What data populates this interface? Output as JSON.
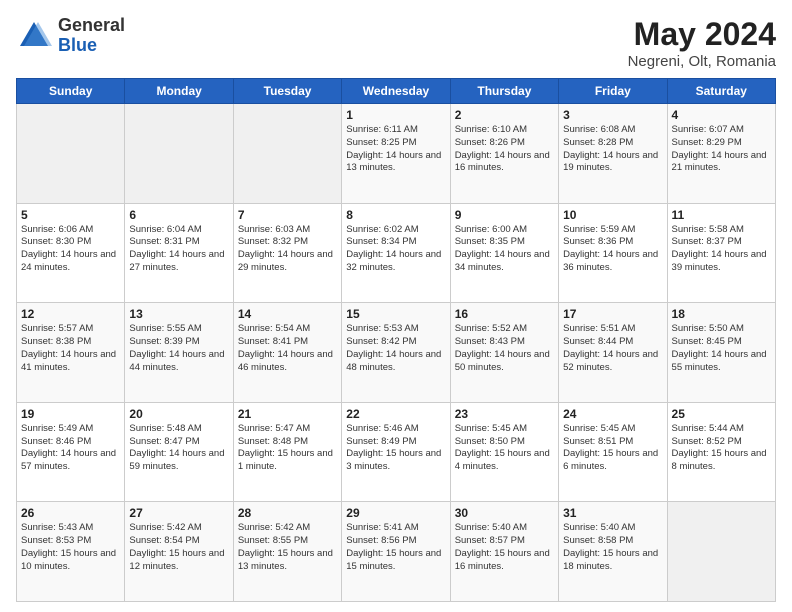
{
  "header": {
    "logo_general": "General",
    "logo_blue": "Blue",
    "title": "May 2024",
    "location": "Negreni, Olt, Romania"
  },
  "days_of_week": [
    "Sunday",
    "Monday",
    "Tuesday",
    "Wednesday",
    "Thursday",
    "Friday",
    "Saturday"
  ],
  "weeks": [
    [
      {
        "day": "",
        "info": ""
      },
      {
        "day": "",
        "info": ""
      },
      {
        "day": "",
        "info": ""
      },
      {
        "day": "1",
        "info": "Sunrise: 6:11 AM\nSunset: 8:25 PM\nDaylight: 14 hours and 13 minutes."
      },
      {
        "day": "2",
        "info": "Sunrise: 6:10 AM\nSunset: 8:26 PM\nDaylight: 14 hours and 16 minutes."
      },
      {
        "day": "3",
        "info": "Sunrise: 6:08 AM\nSunset: 8:28 PM\nDaylight: 14 hours and 19 minutes."
      },
      {
        "day": "4",
        "info": "Sunrise: 6:07 AM\nSunset: 8:29 PM\nDaylight: 14 hours and 21 minutes."
      }
    ],
    [
      {
        "day": "5",
        "info": "Sunrise: 6:06 AM\nSunset: 8:30 PM\nDaylight: 14 hours and 24 minutes."
      },
      {
        "day": "6",
        "info": "Sunrise: 6:04 AM\nSunset: 8:31 PM\nDaylight: 14 hours and 27 minutes."
      },
      {
        "day": "7",
        "info": "Sunrise: 6:03 AM\nSunset: 8:32 PM\nDaylight: 14 hours and 29 minutes."
      },
      {
        "day": "8",
        "info": "Sunrise: 6:02 AM\nSunset: 8:34 PM\nDaylight: 14 hours and 32 minutes."
      },
      {
        "day": "9",
        "info": "Sunrise: 6:00 AM\nSunset: 8:35 PM\nDaylight: 14 hours and 34 minutes."
      },
      {
        "day": "10",
        "info": "Sunrise: 5:59 AM\nSunset: 8:36 PM\nDaylight: 14 hours and 36 minutes."
      },
      {
        "day": "11",
        "info": "Sunrise: 5:58 AM\nSunset: 8:37 PM\nDaylight: 14 hours and 39 minutes."
      }
    ],
    [
      {
        "day": "12",
        "info": "Sunrise: 5:57 AM\nSunset: 8:38 PM\nDaylight: 14 hours and 41 minutes."
      },
      {
        "day": "13",
        "info": "Sunrise: 5:55 AM\nSunset: 8:39 PM\nDaylight: 14 hours and 44 minutes."
      },
      {
        "day": "14",
        "info": "Sunrise: 5:54 AM\nSunset: 8:41 PM\nDaylight: 14 hours and 46 minutes."
      },
      {
        "day": "15",
        "info": "Sunrise: 5:53 AM\nSunset: 8:42 PM\nDaylight: 14 hours and 48 minutes."
      },
      {
        "day": "16",
        "info": "Sunrise: 5:52 AM\nSunset: 8:43 PM\nDaylight: 14 hours and 50 minutes."
      },
      {
        "day": "17",
        "info": "Sunrise: 5:51 AM\nSunset: 8:44 PM\nDaylight: 14 hours and 52 minutes."
      },
      {
        "day": "18",
        "info": "Sunrise: 5:50 AM\nSunset: 8:45 PM\nDaylight: 14 hours and 55 minutes."
      }
    ],
    [
      {
        "day": "19",
        "info": "Sunrise: 5:49 AM\nSunset: 8:46 PM\nDaylight: 14 hours and 57 minutes."
      },
      {
        "day": "20",
        "info": "Sunrise: 5:48 AM\nSunset: 8:47 PM\nDaylight: 14 hours and 59 minutes."
      },
      {
        "day": "21",
        "info": "Sunrise: 5:47 AM\nSunset: 8:48 PM\nDaylight: 15 hours and 1 minute."
      },
      {
        "day": "22",
        "info": "Sunrise: 5:46 AM\nSunset: 8:49 PM\nDaylight: 15 hours and 3 minutes."
      },
      {
        "day": "23",
        "info": "Sunrise: 5:45 AM\nSunset: 8:50 PM\nDaylight: 15 hours and 4 minutes."
      },
      {
        "day": "24",
        "info": "Sunrise: 5:45 AM\nSunset: 8:51 PM\nDaylight: 15 hours and 6 minutes."
      },
      {
        "day": "25",
        "info": "Sunrise: 5:44 AM\nSunset: 8:52 PM\nDaylight: 15 hours and 8 minutes."
      }
    ],
    [
      {
        "day": "26",
        "info": "Sunrise: 5:43 AM\nSunset: 8:53 PM\nDaylight: 15 hours and 10 minutes."
      },
      {
        "day": "27",
        "info": "Sunrise: 5:42 AM\nSunset: 8:54 PM\nDaylight: 15 hours and 12 minutes."
      },
      {
        "day": "28",
        "info": "Sunrise: 5:42 AM\nSunset: 8:55 PM\nDaylight: 15 hours and 13 minutes."
      },
      {
        "day": "29",
        "info": "Sunrise: 5:41 AM\nSunset: 8:56 PM\nDaylight: 15 hours and 15 minutes."
      },
      {
        "day": "30",
        "info": "Sunrise: 5:40 AM\nSunset: 8:57 PM\nDaylight: 15 hours and 16 minutes."
      },
      {
        "day": "31",
        "info": "Sunrise: 5:40 AM\nSunset: 8:58 PM\nDaylight: 15 hours and 18 minutes."
      },
      {
        "day": "",
        "info": ""
      }
    ]
  ]
}
